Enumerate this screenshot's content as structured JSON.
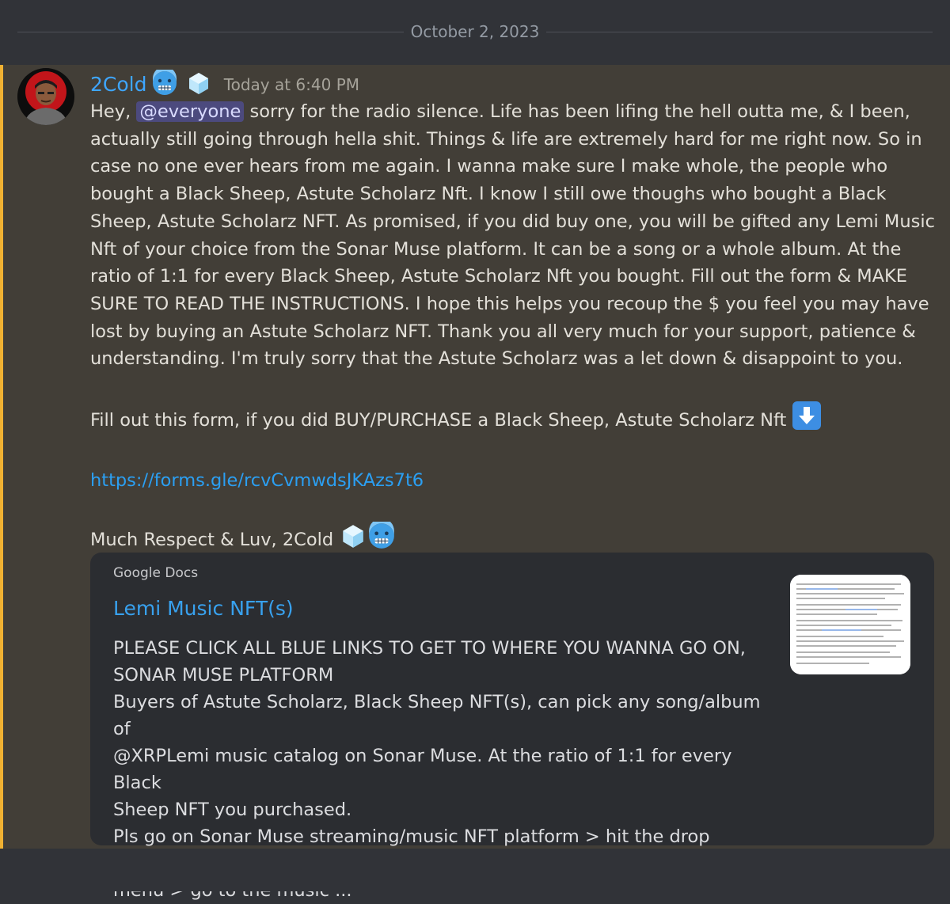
{
  "date_divider": "October 2, 2023",
  "message": {
    "author": "2Cold",
    "timestamp": "Today at 6:40 PM",
    "mention": "@everyone",
    "text_before_mention": "Hey, ",
    "paragraph_1": " sorry for the radio silence. Life has been lifing the hell outta me, & I been, actually still going through hella shit. Things & life are extremely hard for me right now. So in case no one ever hears from me again. I wanna make sure I make whole, the people who bought a Black Sheep, Astute Scholarz Nft. I know I still owe thoughs who bought a Black Sheep, Astute Scholarz NFT. As promised, if you did buy one, you will be gifted any Lemi Music Nft of your choice from the Sonar Muse platform. It can be a song or a whole album. At the ratio of 1:1 for every Black Sheep, Astute Scholarz Nft you bought. Fill out the form & MAKE SURE TO READ THE INSTRUCTIONS. I hope this helps you recoup the $ you feel you may have lost by buying an Astute Scholarz NFT.  Thank you all very much for your support, patience & understanding. I'm truly sorry that the Astute Scholarz was a let down & disappoint to you.",
    "paragraph_2": "Fill out this form, if you did BUY/PURCHASE a Black Sheep, Astute Scholarz Nft ",
    "link": "https://forms.gle/rcvCvmwdsJKAzs7t6",
    "signoff": "Much Respect & Luv, 2Cold "
  },
  "embed": {
    "provider": "Google Docs",
    "title": "Lemi Music NFT(s)",
    "description_lines": [
      "PLEASE CLICK ALL BLUE LINKS TO GET TO WHERE YOU WANNA GO ON,",
      "SONAR MUSE PLATFORM",
      "Buyers of Astute Scholarz, Black Sheep NFT(s), can pick any song/album of",
      "@XRPLemi music catalog on Sonar Muse. At the ratio of 1:1 for every Black",
      "Sheep NFT you purchased.",
      "Pls go on Sonar Muse streaming/music NFT platform > hit the drop down",
      "menu > go to the music ..."
    ]
  },
  "icons": {
    "author_emoji_1": "cold-face-icon",
    "author_emoji_2": "ice-cube-icon",
    "arrow": "down-arrow-button-icon",
    "signoff_emoji_1": "ice-cube-icon",
    "signoff_emoji_2": "cold-face-icon"
  },
  "colors": {
    "background": "#313338",
    "highlight": "#423e37",
    "highlight_bar": "#f0b132",
    "username": "#3ea6ff",
    "link": "#2b9ff2",
    "mention_bg": "#4c4a7e",
    "embed_bg": "#2b2d31"
  }
}
